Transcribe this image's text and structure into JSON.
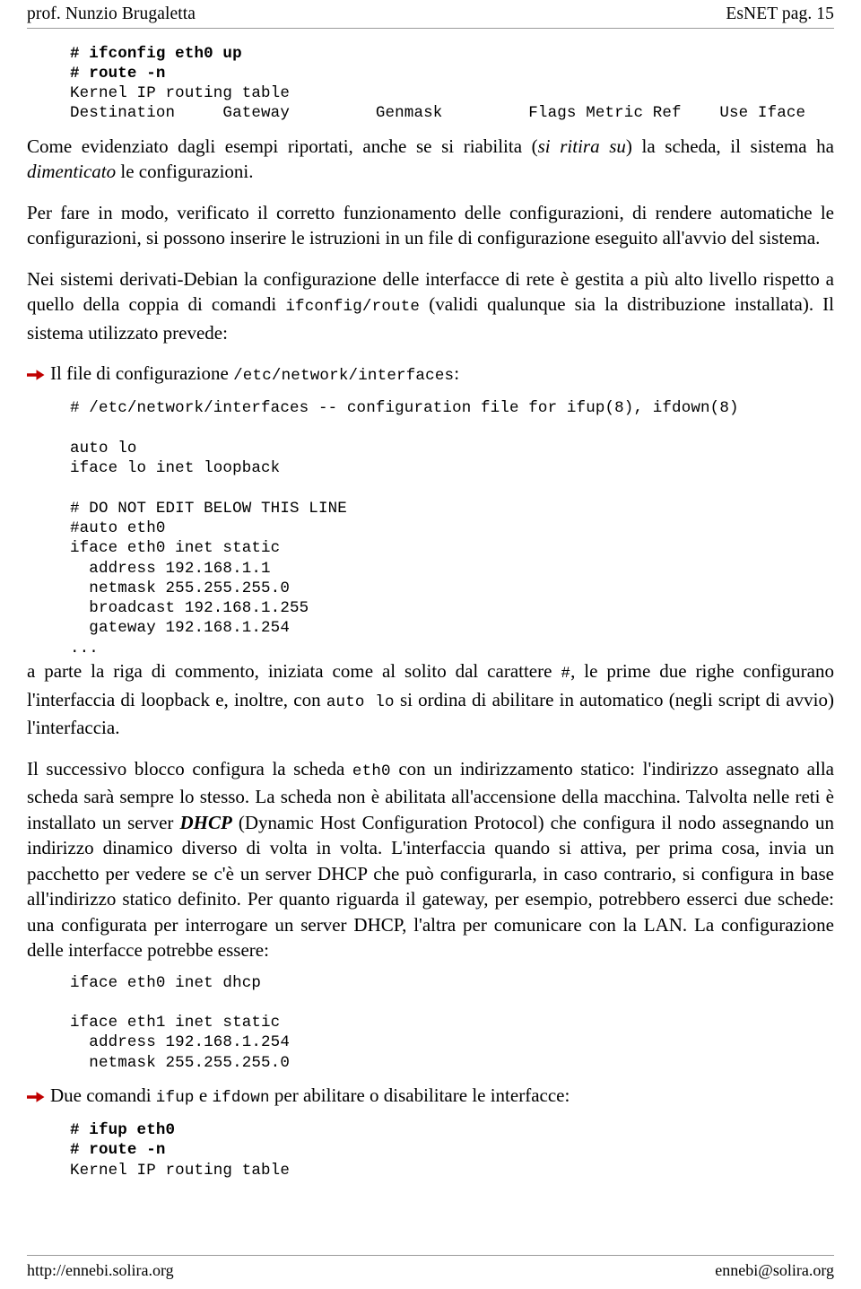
{
  "header": {
    "left": "prof. Nunzio Brugaletta",
    "right": "EsNET pag. 15"
  },
  "footer": {
    "left": "http://ennebi.solira.org",
    "right": "ennebi@solira.org"
  },
  "colors": {
    "bullet_arrow": "#c00000",
    "rule": "#9a9a9a",
    "text": "#000000"
  },
  "code_block_1": "# ifconfig eth0 up\n# route -n\nKernel IP routing table\nDestination     Gateway         Genmask         Flags Metric Ref    Use Iface",
  "code_block_1_bold_lines": "# ifconfig eth0 up\n# route -n",
  "para_1": {
    "t1": "Come evidenziato dagli esempi riportati, anche se si riabilita (",
    "i1": "si ritira su",
    "t2": ") la scheda, il sistema ha ",
    "i2": "dimenticato",
    "t3": " le configurazioni."
  },
  "para_2": "Per fare in modo, verificato il corretto funzionamento delle configurazioni, di rendere automatiche le configurazioni, si possono inserire le istruzioni in un file di configurazione eseguito all'avvio del sistema.",
  "para_3": {
    "t1": "Nei sistemi derivati-Debian la configurazione delle interfacce di rete è gestita a più alto livello rispetto a quello della coppia di comandi ",
    "c1": "ifconfig/route",
    "t2": " (validi qualunque sia la distribuzione installata). Il sistema utilizzato prevede:"
  },
  "bullet_1": {
    "icon": "arrow-right-icon",
    "t1": "Il file di configurazione ",
    "c1": "/etc/network/interfaces",
    "t2": ":"
  },
  "code_block_2": "# /etc/network/interfaces -- configuration file for ifup(8), ifdown(8)\n\nauto lo\niface lo inet loopback\n\n# DO NOT EDIT BELOW THIS LINE\n#auto eth0\niface eth0 inet static\n  address 192.168.1.1\n  netmask 255.255.255.0\n  broadcast 192.168.1.255\n  gateway 192.168.1.254\n...",
  "para_4": {
    "t1": "a parte la riga di commento, iniziata come al solito dal carattere ",
    "c1": "#",
    "t2": ", le prime due righe configurano l'interfaccia di loopback e, inoltre, con ",
    "c2": "auto lo",
    "t3": " si ordina di abilitare in automatico (negli script di avvio) l'interfaccia."
  },
  "para_5": {
    "t1": "Il successivo blocco configura la scheda ",
    "c1": "eth0",
    "t2": " con un indirizzamento statico: l'indirizzo assegnato alla scheda sarà sempre lo stesso. La scheda non è abilitata all'accensione della macchina. Talvolta nelle reti è installato un server ",
    "b1": "DHCP",
    "t3": " (Dynamic Host Configuration Protocol) che configura il nodo assegnando un indirizzo dinamico diverso di volta in volta. L'interfaccia quando si attiva, per prima cosa, invia un pacchetto per vedere se c'è un server DHCP che può configurarla, in caso contrario, si configura in base all'indirizzo statico definito. Per quanto riguarda il gateway, per esempio, potrebbero esserci due schede: una configurata per interrogare un server DHCP, l'altra per comunicare con la LAN. La configurazione delle interfacce potrebbe essere:"
  },
  "code_block_3": "iface eth0 inet dhcp\n\niface eth1 inet static\n  address 192.168.1.254\n  netmask 255.255.255.0",
  "bullet_2": {
    "icon": "arrow-right-icon",
    "t1": "Due comandi ",
    "c1": "ifup",
    "t2": " e ",
    "c2": "ifdown",
    "t3": " per abilitare o disabilitare le interfacce:"
  },
  "code_block_4": "# ifup eth0\n# route -n\nKernel IP routing table",
  "code_block_4_bold_lines": "# ifup eth0\n# route -n"
}
